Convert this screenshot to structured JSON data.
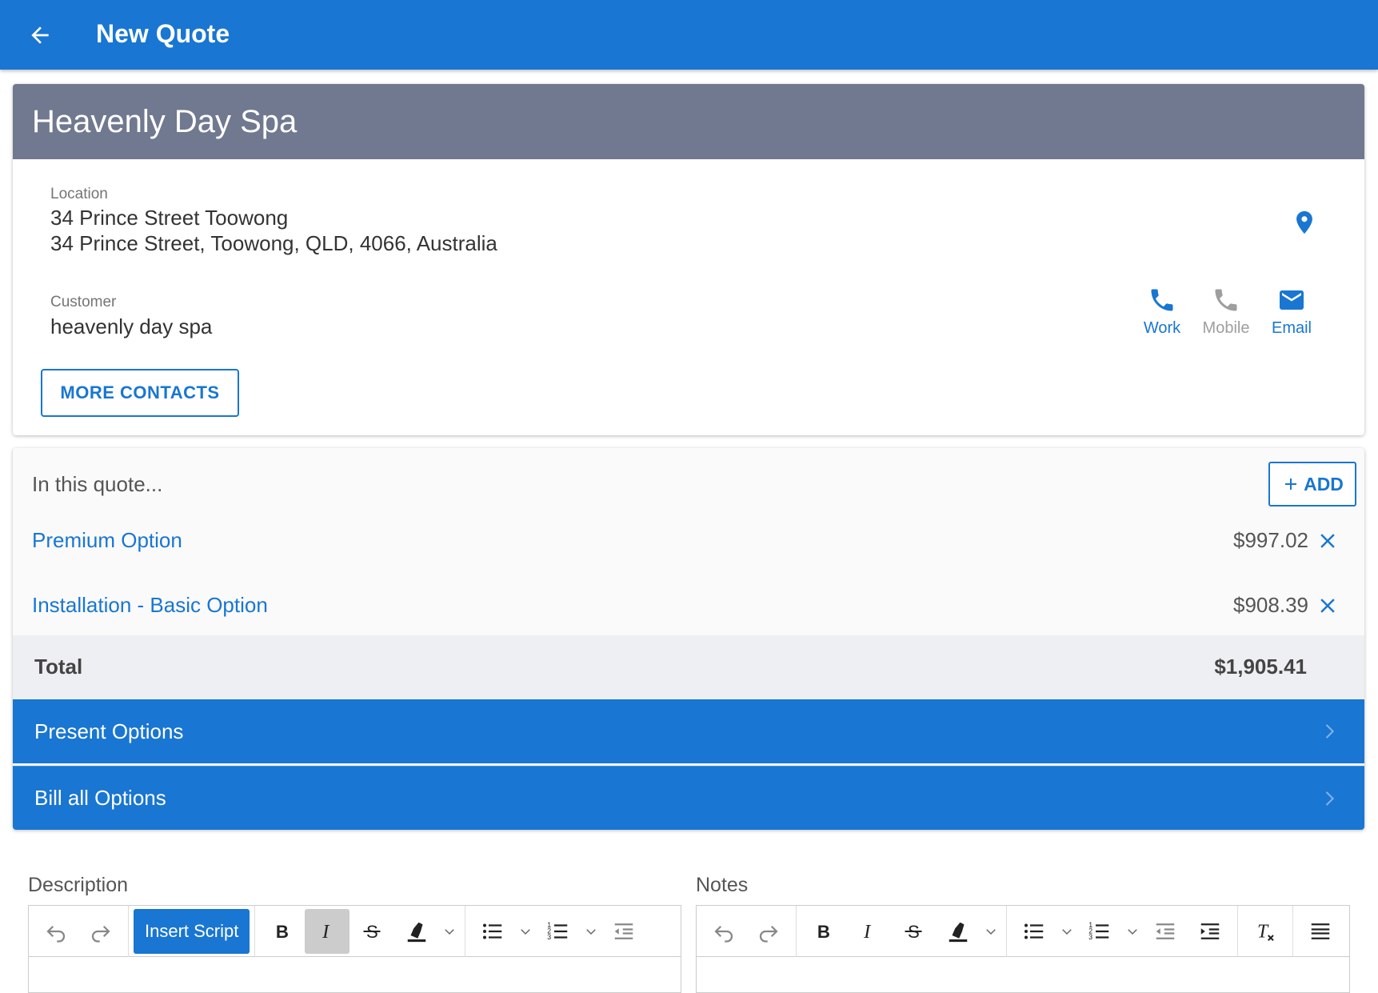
{
  "appbar": {
    "title": "New Quote"
  },
  "site": {
    "name": "Heavenly Day Spa"
  },
  "location": {
    "label": "Location",
    "line1": "34 Prince Street Toowong",
    "line2": "34 Prince Street, Toowong, QLD, 4066, Australia"
  },
  "customer": {
    "label": "Customer",
    "name": "heavenly day spa"
  },
  "contacts": [
    {
      "label": "Work",
      "color": "#1976d2"
    },
    {
      "label": "Mobile",
      "color": "#9e9e9e"
    },
    {
      "label": "Email",
      "color": "#1976d2"
    }
  ],
  "more_contacts_label": "MORE CONTACTS",
  "quote": {
    "heading": "In this quote...",
    "add_label": "ADD",
    "items": [
      {
        "name": "Premium Option",
        "price": "$997.02"
      },
      {
        "name": "Installation - Basic Option",
        "price": "$908.39"
      }
    ],
    "total_label": "Total",
    "total_value": "$1,905.41"
  },
  "actions": {
    "present": "Present Options",
    "bill": "Bill all Options"
  },
  "description": {
    "label": "Description",
    "insert_script": "Insert Script"
  },
  "notes": {
    "label": "Notes"
  },
  "colors": {
    "primary": "#1976d2",
    "header_grey": "#70798f"
  }
}
